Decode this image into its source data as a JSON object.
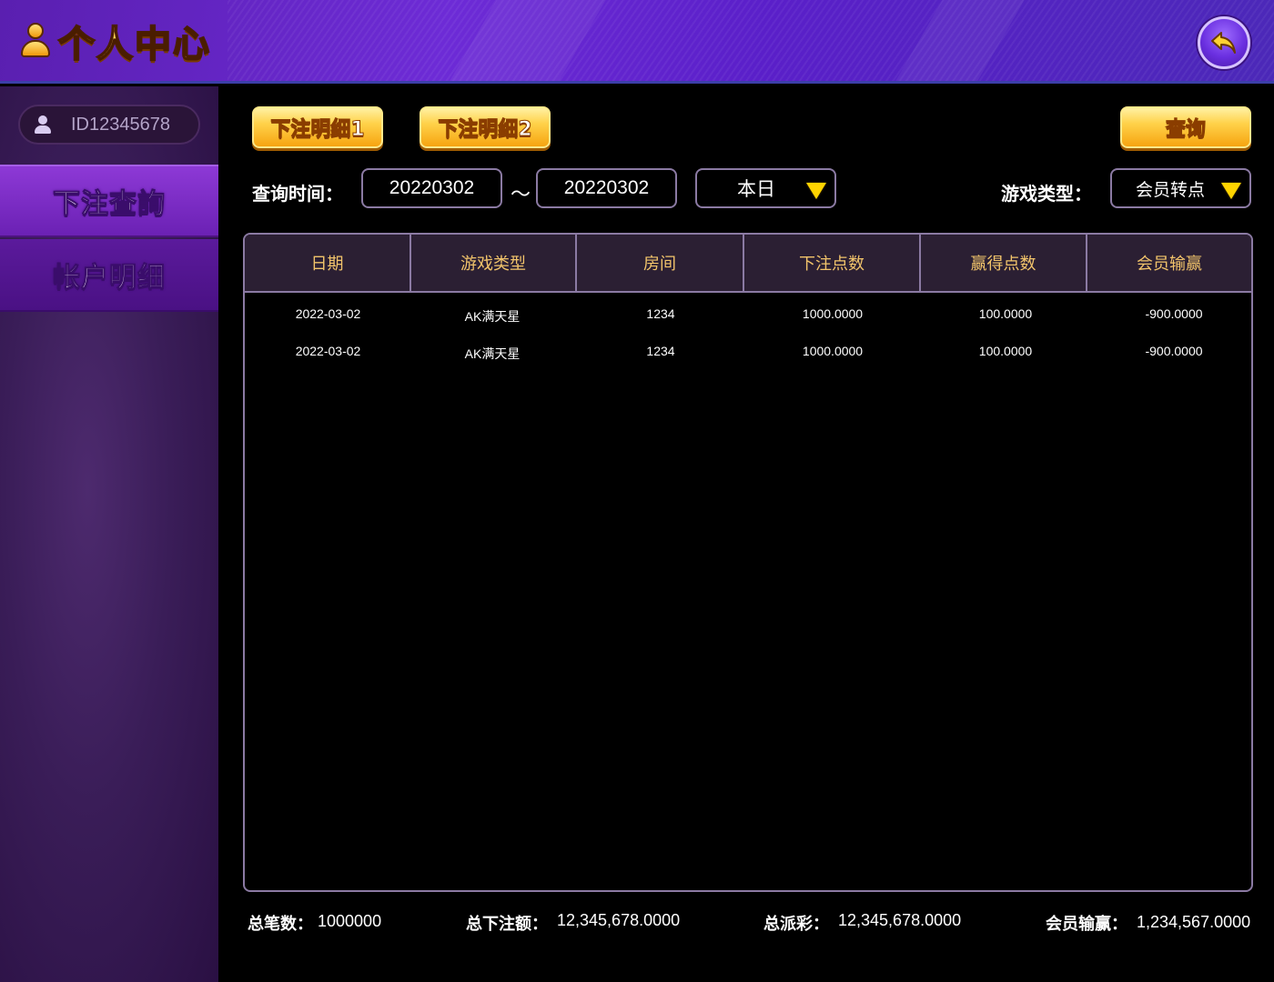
{
  "header": {
    "title": "个人中心"
  },
  "sidebar": {
    "user_id": "ID12345678",
    "items": [
      {
        "label": "下注查詢",
        "active": true
      },
      {
        "label": "帐户明细",
        "active": false
      }
    ]
  },
  "toolbar": {
    "tab1_label": "下注明细1",
    "tab2_label": "下注明细2",
    "query_label": "查询"
  },
  "filters": {
    "time_label": "查询时间：",
    "start_date": "20220302",
    "separator": "～",
    "end_date": "20220302",
    "range_value": "本日",
    "game_type_label": "游戏类型：",
    "game_type_value": "会员转点"
  },
  "table": {
    "columns": [
      "日期",
      "游戏类型",
      "房间",
      "下注点数",
      "赢得点数",
      "会员输赢"
    ],
    "rows": [
      [
        "2022-03-02",
        "AK满天星",
        "1234",
        "1000.0000",
        "100.0000",
        "-900.0000"
      ],
      [
        "2022-03-02",
        "AK满天星",
        "1234",
        "1000.0000",
        "100.0000",
        "-900.0000"
      ]
    ]
  },
  "totals": {
    "count_label": "总笔数：",
    "count_value": "1000000",
    "bet_label": "总下注额：",
    "bet_value": "12,345,678.0000",
    "payout_label": "总派彩：",
    "payout_value": "12,345,678.0000",
    "win_label": "会员输赢：",
    "win_value": "1,234,567.0000"
  },
  "colors": {
    "accent_gold": "#ffd24a",
    "header_purple": "#6d2bd6",
    "column_header_text": "#f2c46b"
  }
}
